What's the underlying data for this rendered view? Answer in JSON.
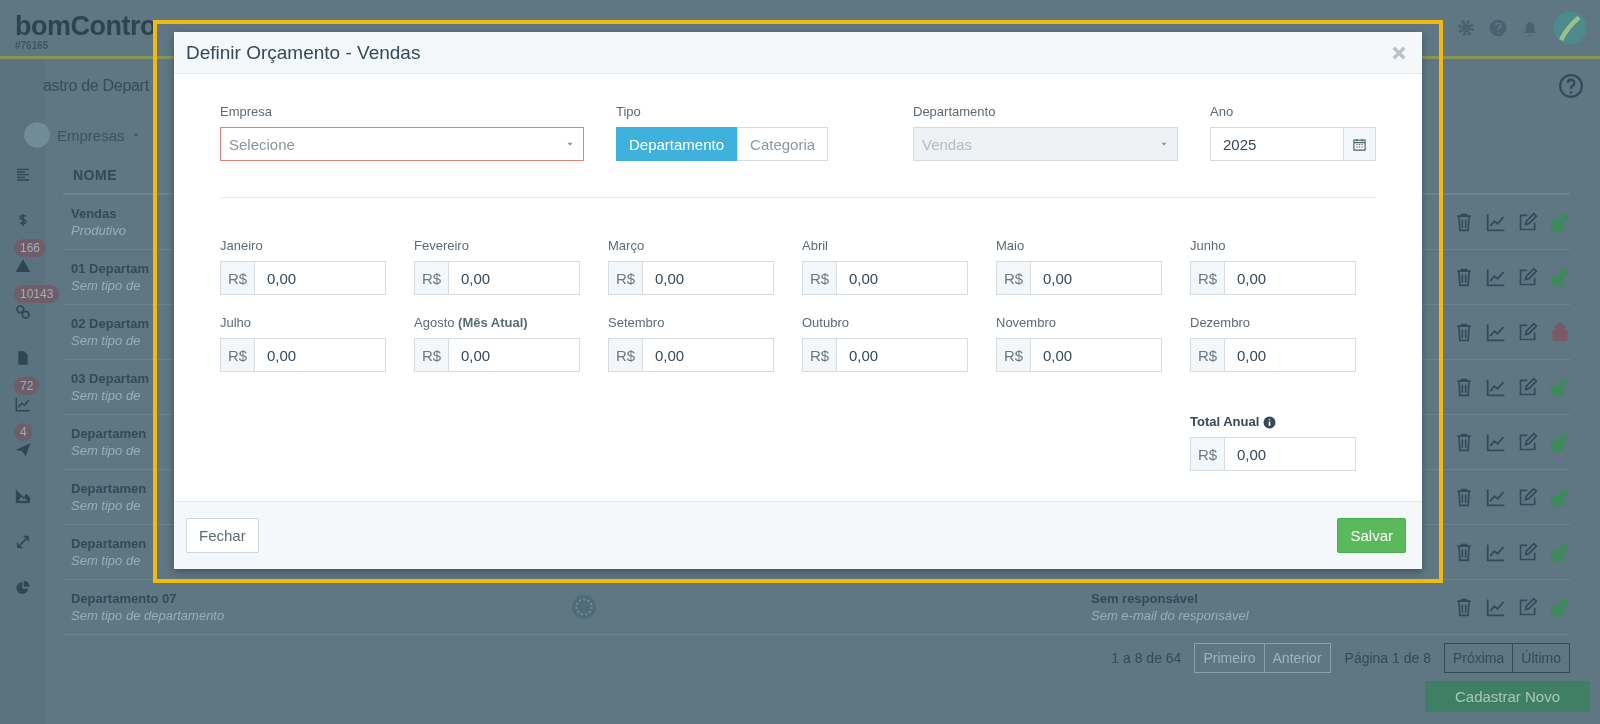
{
  "header": {
    "logo": "bomContro",
    "account": "#76165"
  },
  "page": {
    "title": "astro de Depart",
    "filter": "Empresas"
  },
  "sidebar": [
    {
      "kind": "list"
    },
    {
      "kind": "dollar"
    },
    {
      "kind": "warning",
      "badge": "166"
    },
    {
      "kind": "link",
      "badge": "10143"
    },
    {
      "kind": "file"
    },
    {
      "kind": "linechart",
      "badge": "72"
    },
    {
      "kind": "plane",
      "badge": "4"
    },
    {
      "kind": "areachart"
    },
    {
      "kind": "expand"
    },
    {
      "kind": "pie"
    }
  ],
  "table": {
    "columns": [
      "NOME"
    ],
    "rows": [
      {
        "name": "Vendas",
        "subtitle": "Produtivo",
        "locked": false,
        "emblem": false
      },
      {
        "name": "01 Departam",
        "subtitle": "Sem tipo de",
        "locked": false,
        "emblem": false
      },
      {
        "name": "02 Departam",
        "subtitle": "Sem tipo de",
        "locked": true,
        "emblem": false
      },
      {
        "name": "03 Departam",
        "subtitle": "Sem tipo de",
        "locked": false,
        "emblem": false
      },
      {
        "name": "Departamen",
        "subtitle": "Sem tipo de",
        "locked": false,
        "emblem": false
      },
      {
        "name": "Departamen",
        "subtitle": "Sem tipo de",
        "locked": false,
        "emblem": false
      },
      {
        "name": "Departamen",
        "subtitle": "Sem tipo de",
        "locked": false,
        "emblem": false
      },
      {
        "name": "Departamento 07",
        "subtitle": "Sem tipo de departamento",
        "responsible": "Sem responsável",
        "email": "Sem e-mail do responsável",
        "locked": false,
        "emblem": true
      }
    ]
  },
  "pagination": {
    "summary": "1 a 8 de 64",
    "left_buttons": [
      {
        "label": "Primeiro",
        "disabled": true
      },
      {
        "label": "Anterior",
        "disabled": true
      }
    ],
    "page_label": "Página 1 de 8",
    "right_buttons": [
      {
        "label": "Próxima",
        "disabled": false
      },
      {
        "label": "Último",
        "disabled": false
      }
    ]
  },
  "primary_button": "Cadastrar Novo",
  "modal": {
    "title": "Definir Orçamento - Vendas",
    "company": {
      "label": "Empresa",
      "placeholder": "Selecione",
      "invalid": true
    },
    "type": {
      "label": "Tipo",
      "options": [
        {
          "label": "Departamento",
          "selected": true
        },
        {
          "label": "Categoria",
          "selected": false
        }
      ]
    },
    "department": {
      "label": "Departamento",
      "value": "Vendas",
      "disabled": true
    },
    "year": {
      "label": "Ano",
      "value": "2025"
    },
    "months": [
      {
        "label": "Janeiro",
        "prefix": "R$",
        "value": "0,00"
      },
      {
        "label": "Fevereiro",
        "prefix": "R$",
        "value": "0,00"
      },
      {
        "label": "Março",
        "prefix": "R$",
        "value": "0,00"
      },
      {
        "label": "Abril",
        "prefix": "R$",
        "value": "0,00"
      },
      {
        "label": "Maio",
        "prefix": "R$",
        "value": "0,00"
      },
      {
        "label": "Junho",
        "prefix": "R$",
        "value": "0,00"
      },
      {
        "label": "Julho",
        "prefix": "R$",
        "value": "0,00"
      },
      {
        "label": "Agosto **(Mês Atual)**",
        "prefix": "R$",
        "value": "0,00"
      },
      {
        "label": "Setembro",
        "prefix": "R$",
        "value": "0,00"
      },
      {
        "label": "Outubro",
        "prefix": "R$",
        "value": "0,00"
      },
      {
        "label": "Novembro",
        "prefix": "R$",
        "value": "0,00"
      },
      {
        "label": "Dezembro",
        "prefix": "R$",
        "value": "0,00"
      }
    ],
    "total": {
      "label": "Total Anual",
      "prefix": "R$",
      "value": "0,00"
    },
    "buttons": [
      {
        "label": "Fechar",
        "kind": "default"
      },
      {
        "label": "Salvar",
        "kind": "success"
      }
    ]
  }
}
